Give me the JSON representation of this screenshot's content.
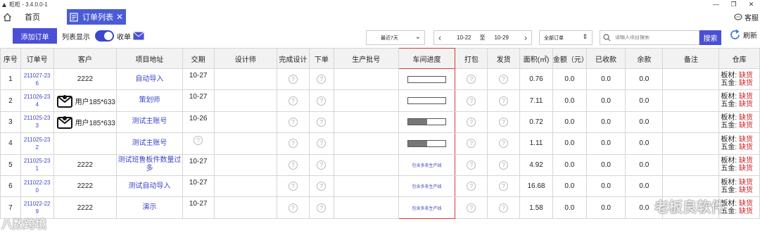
{
  "window": {
    "title": "柜柜 - 3.4.0.0-1",
    "controls": [
      "—",
      "❐",
      "✕"
    ]
  },
  "tabs": {
    "home": "首页",
    "active": "订单列表",
    "close": "✕"
  },
  "service_label": "客服",
  "toolbar": {
    "add_order": "添加订单",
    "list_display": "列表显示",
    "collect": "收单",
    "date_preset": "最近7天",
    "date_from": "10-22",
    "date_to_label": "至",
    "date_to": "10-29",
    "order_filter": "全部订单",
    "search_placeholder": "请输入项目搜索",
    "search_button": "搜索",
    "refresh": "刷新"
  },
  "table": {
    "headers": [
      "序号",
      "订单号",
      "客户",
      "项目地址",
      "交期",
      "设计师",
      "完成设计",
      "下单",
      "生产批号",
      "车间进度",
      "打包",
      "发货",
      "面积(㎡)",
      "金额（元）",
      "已收款",
      "余款",
      "备注",
      "仓库"
    ],
    "stock_labels": {
      "board": "板材:",
      "hardware": "五金:",
      "status": "缺货"
    },
    "multi_line_label": "包含多条生产线",
    "rows": [
      {
        "seq": "1",
        "order_no": "211027-23\n6",
        "customer": "2222",
        "customer_avatar": false,
        "project": "自动导入",
        "delivery": "10-27",
        "progress": "bar",
        "progress_fill": 0,
        "area": "0.76",
        "amount": "0.0",
        "received": "0.0",
        "balance": "0.0"
      },
      {
        "seq": "2",
        "order_no": "211026-23\n4",
        "customer": "用户185*633",
        "customer_avatar": true,
        "project": "策划师",
        "delivery": "10-27",
        "progress": "bar",
        "progress_fill": 0,
        "area": "7.11",
        "amount": "0.0",
        "received": "0.0",
        "balance": "0.0"
      },
      {
        "seq": "3",
        "order_no": "211025-23\n3",
        "customer": "用户185*633",
        "customer_avatar": true,
        "project": "测试主账号",
        "delivery": "10-26",
        "progress": "bar",
        "progress_fill": 0.5,
        "area": "0.72",
        "amount": "0.0",
        "received": "0.0",
        "balance": "0.0"
      },
      {
        "seq": "4",
        "order_no": "211025-23\n2",
        "customer": "",
        "customer_avatar": false,
        "project": "测试主账号",
        "delivery": "",
        "progress": "bar",
        "progress_fill": 0.5,
        "area": "1.11",
        "amount": "0.0",
        "received": "0.0",
        "balance": "0.0"
      },
      {
        "seq": "5",
        "order_no": "211025-23\n1",
        "customer": "2222",
        "customer_avatar": false,
        "project": "测试班鲁板件数量过多",
        "delivery": "10-27",
        "progress": "multi",
        "progress_fill": 0,
        "area": "4.92",
        "amount": "0.0",
        "received": "0.0",
        "balance": "0.0"
      },
      {
        "seq": "6",
        "order_no": "211022-23\n0",
        "customer": "2222",
        "customer_avatar": false,
        "project": "测试自动导入",
        "delivery": "10-27",
        "progress": "multi",
        "progress_fill": 0,
        "area": "16.68",
        "amount": "0.0",
        "received": "0.0",
        "balance": "0.0"
      },
      {
        "seq": "7",
        "order_no": "211022-22\n9",
        "customer": "2222",
        "customer_avatar": false,
        "project": "演示",
        "delivery": "10-27",
        "progress": "multi",
        "progress_fill": 0,
        "area": "1.58",
        "amount": "0.0",
        "received": "0.0",
        "balance": "0.0"
      }
    ]
  },
  "watermarks": {
    "left": "八数跨境",
    "right": "老板良软件"
  },
  "colors": {
    "accent": "#4a4fd6",
    "link": "#3b47c8",
    "danger": "#d42020",
    "progress_border": "#d43c3c"
  }
}
